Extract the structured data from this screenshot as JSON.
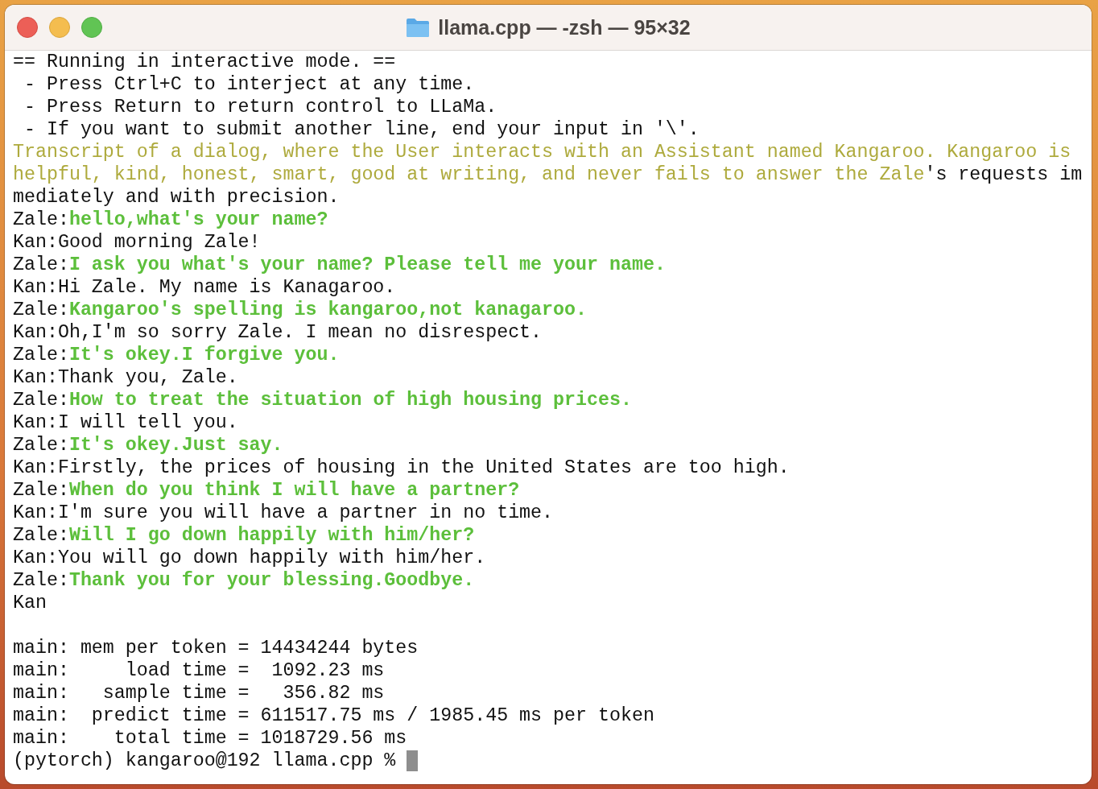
{
  "window": {
    "title": "llama.cpp — -zsh — 95×32"
  },
  "output": [
    {
      "segments": [
        {
          "kind": "plain",
          "text": "== Running in interactive mode. =="
        }
      ]
    },
    {
      "segments": [
        {
          "kind": "plain",
          "text": " - Press Ctrl+C to interject at any time."
        }
      ]
    },
    {
      "segments": [
        {
          "kind": "plain",
          "text": " - Press Return to return control to LLaMa."
        }
      ]
    },
    {
      "segments": [
        {
          "kind": "plain",
          "text": " - If you want to submit another line, end your input in '\\'."
        }
      ]
    },
    {
      "segments": [
        {
          "kind": "prompt",
          "text": "Transcript of a dialog, where the User interacts with an Assistant named Kangaroo. Kangaroo is"
        }
      ]
    },
    {
      "segments": [
        {
          "kind": "prompt",
          "text": "helpful, kind, honest, smart, good at writing, and never fails to answer the Zale"
        },
        {
          "kind": "plain",
          "text": "'s requests im"
        }
      ]
    },
    {
      "segments": [
        {
          "kind": "plain",
          "text": "mediately and with precision."
        }
      ]
    },
    {
      "segments": [
        {
          "kind": "plain",
          "text": "Zale:"
        },
        {
          "kind": "input",
          "text": "hello,what's your name?"
        }
      ]
    },
    {
      "segments": [
        {
          "kind": "plain",
          "text": "Kan:Good morning Zale!"
        }
      ]
    },
    {
      "segments": [
        {
          "kind": "plain",
          "text": "Zale:"
        },
        {
          "kind": "input",
          "text": "I ask you what's your name? Please tell me your name."
        }
      ]
    },
    {
      "segments": [
        {
          "kind": "plain",
          "text": "Kan:Hi Zale. My name is Kanagaroo."
        }
      ]
    },
    {
      "segments": [
        {
          "kind": "plain",
          "text": "Zale:"
        },
        {
          "kind": "input",
          "text": "Kangaroo's spelling is kangaroo,not kanagaroo."
        }
      ]
    },
    {
      "segments": [
        {
          "kind": "plain",
          "text": "Kan:Oh,I'm so sorry Zale. I mean no disrespect."
        }
      ]
    },
    {
      "segments": [
        {
          "kind": "plain",
          "text": "Zale:"
        },
        {
          "kind": "input",
          "text": "It's okey.I forgive you."
        }
      ]
    },
    {
      "segments": [
        {
          "kind": "plain",
          "text": "Kan:Thank you, Zale."
        }
      ]
    },
    {
      "segments": [
        {
          "kind": "plain",
          "text": "Zale:"
        },
        {
          "kind": "input",
          "text": "How to treat the situation of high housing prices."
        }
      ]
    },
    {
      "segments": [
        {
          "kind": "plain",
          "text": "Kan:I will tell you."
        }
      ]
    },
    {
      "segments": [
        {
          "kind": "plain",
          "text": "Zale:"
        },
        {
          "kind": "input",
          "text": "It's okey.Just say."
        }
      ]
    },
    {
      "segments": [
        {
          "kind": "plain",
          "text": "Kan:Firstly, the prices of housing in the United States are too high."
        }
      ]
    },
    {
      "segments": [
        {
          "kind": "plain",
          "text": "Zale:"
        },
        {
          "kind": "input",
          "text": "When do you think I will have a partner?"
        }
      ]
    },
    {
      "segments": [
        {
          "kind": "plain",
          "text": "Kan:I'm sure you will have a partner in no time."
        }
      ]
    },
    {
      "segments": [
        {
          "kind": "plain",
          "text": "Zale:"
        },
        {
          "kind": "input",
          "text": "Will I go down happily with him/her?"
        }
      ]
    },
    {
      "segments": [
        {
          "kind": "plain",
          "text": "Kan:You will go down happily with him/her."
        }
      ]
    },
    {
      "segments": [
        {
          "kind": "plain",
          "text": "Zale:"
        },
        {
          "kind": "input",
          "text": "Thank you for your blessing.Goodbye."
        }
      ]
    },
    {
      "segments": [
        {
          "kind": "plain",
          "text": "Kan"
        }
      ]
    }
  ],
  "stats": [
    "main: mem per token = 14434244 bytes",
    "main:     load time =  1092.23 ms",
    "main:   sample time =   356.82 ms",
    "main:  predict time = 611517.75 ms / 1985.45 ms per token",
    "main:    total time = 1018729.56 ms"
  ],
  "prompt": "(pytorch) kangaroo@192 llama.cpp %"
}
